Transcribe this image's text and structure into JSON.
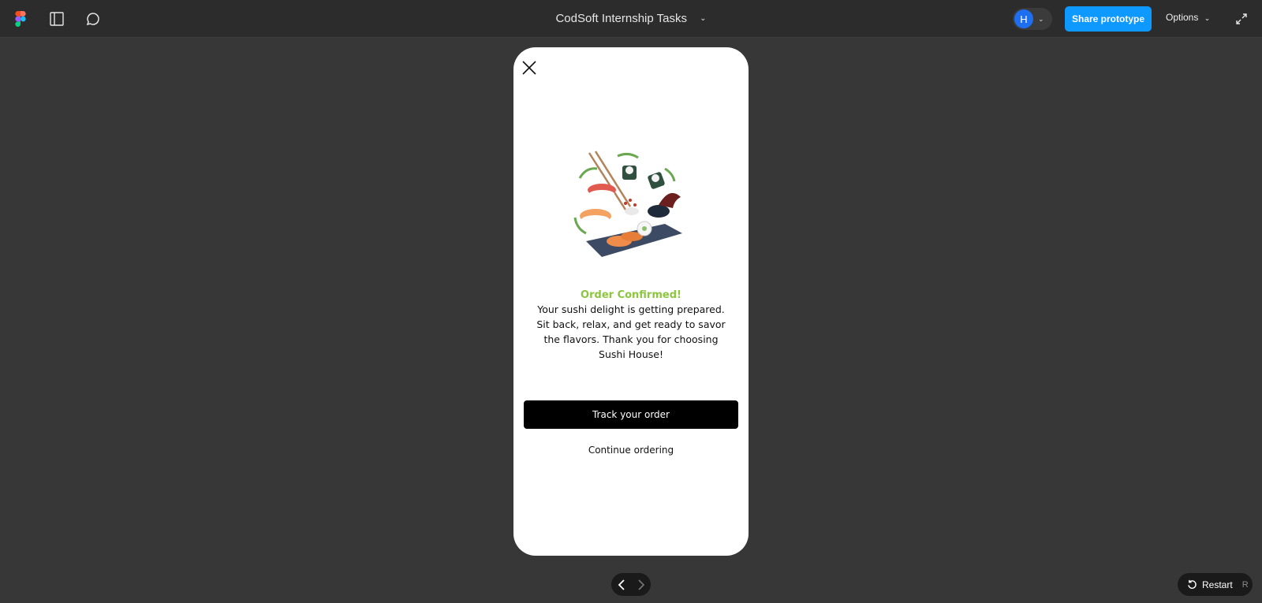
{
  "topbar": {
    "title": "CodSoft Internship Tasks",
    "avatar_initial": "H",
    "share_label": "Share prototype",
    "options_label": "Options"
  },
  "prototype": {
    "heading": "Order Confirmed!",
    "body": "Your sushi delight is getting prepared. Sit back, relax, and get ready to savor the flavors. Thank you for choosing Sushi House!",
    "body_lines": [
      "Your sushi delight is getting prepared.",
      "Sit back, relax, and get ready to savor",
      "the flavors. Thank you for choosing",
      "Sushi House!"
    ],
    "primary_button": "Track your order",
    "secondary_link": "Continue ordering"
  },
  "controls": {
    "restart_label": "Restart",
    "restart_key": "R"
  },
  "icons": {
    "figma": "figma-logo-icon",
    "panel": "sidebar-toggle-icon",
    "comment": "comment-icon",
    "expand": "expand-icon",
    "close": "close-icon",
    "prev": "chevron-left-icon",
    "next": "chevron-right-icon",
    "restart": "restart-icon"
  },
  "colors": {
    "canvas": "#373737",
    "topbar": "#2c2c2c",
    "share_button": "#0d99ff",
    "avatar": "#1e6ff0",
    "heading_green": "#8cc63f",
    "primary_button": "#000000"
  }
}
